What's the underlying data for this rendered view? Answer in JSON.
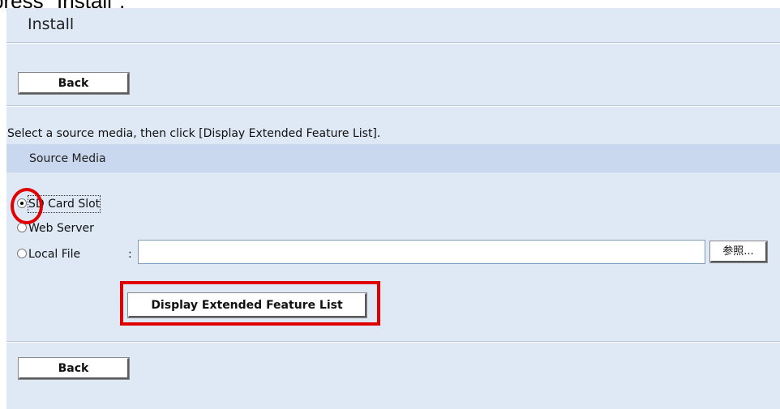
{
  "caption": "press \"Install\".",
  "page": {
    "title": "Install"
  },
  "buttons": {
    "back_top": "Back",
    "back_bottom": "Back",
    "display": "Display Extended Feature List",
    "browse": "参照..."
  },
  "instruction": "Select a source media, then click [Display Extended Feature List].",
  "source_media": {
    "header": "Source Media",
    "options": [
      {
        "label": "SD Card Slot",
        "checked": true
      },
      {
        "label": "Web Server",
        "checked": false
      },
      {
        "label": "Local File",
        "checked": false
      }
    ],
    "separator": ":",
    "local_file_value": ""
  },
  "colors": {
    "panel_bg": "#dfe9f5",
    "section_bg": "#c9d7ef",
    "annotation": "#e00000"
  },
  "icons": {
    "radio": "radio-button-icon"
  }
}
